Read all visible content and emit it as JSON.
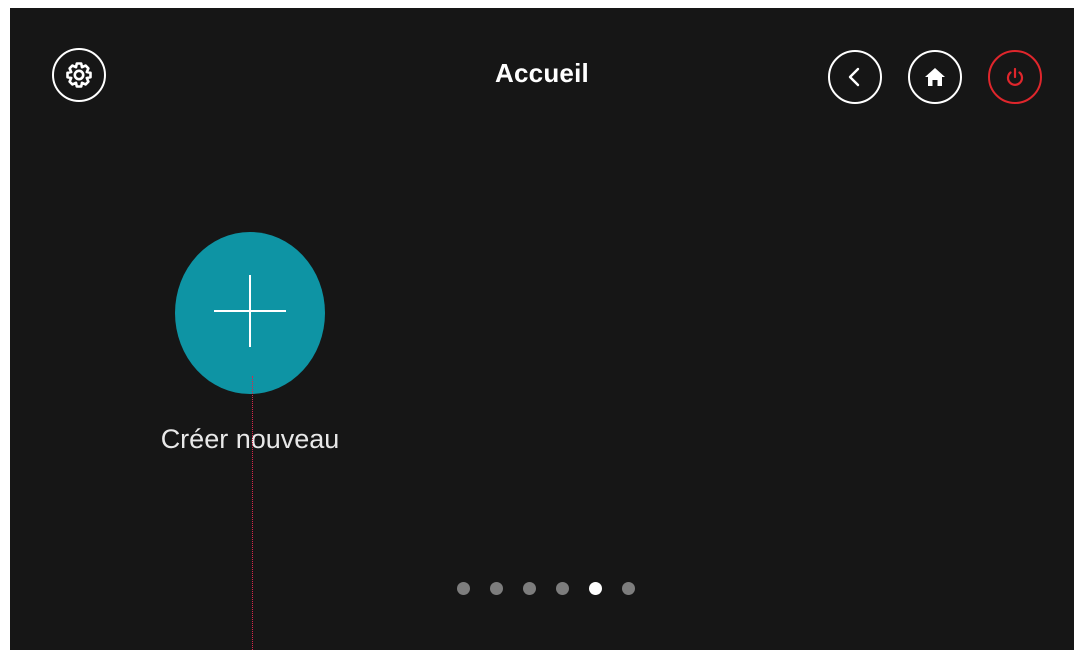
{
  "header": {
    "title": "Accueil",
    "settings_icon": "gear-icon",
    "back_icon": "chevron-left-icon",
    "home_icon": "home-icon",
    "power_icon": "power-icon",
    "power_color": "#e0262c"
  },
  "main": {
    "create_tile": {
      "label": "Créer nouveau",
      "icon": "plus-icon",
      "color": "#0e94a4"
    }
  },
  "pagination": {
    "page_count": 6,
    "active_page": 5
  }
}
